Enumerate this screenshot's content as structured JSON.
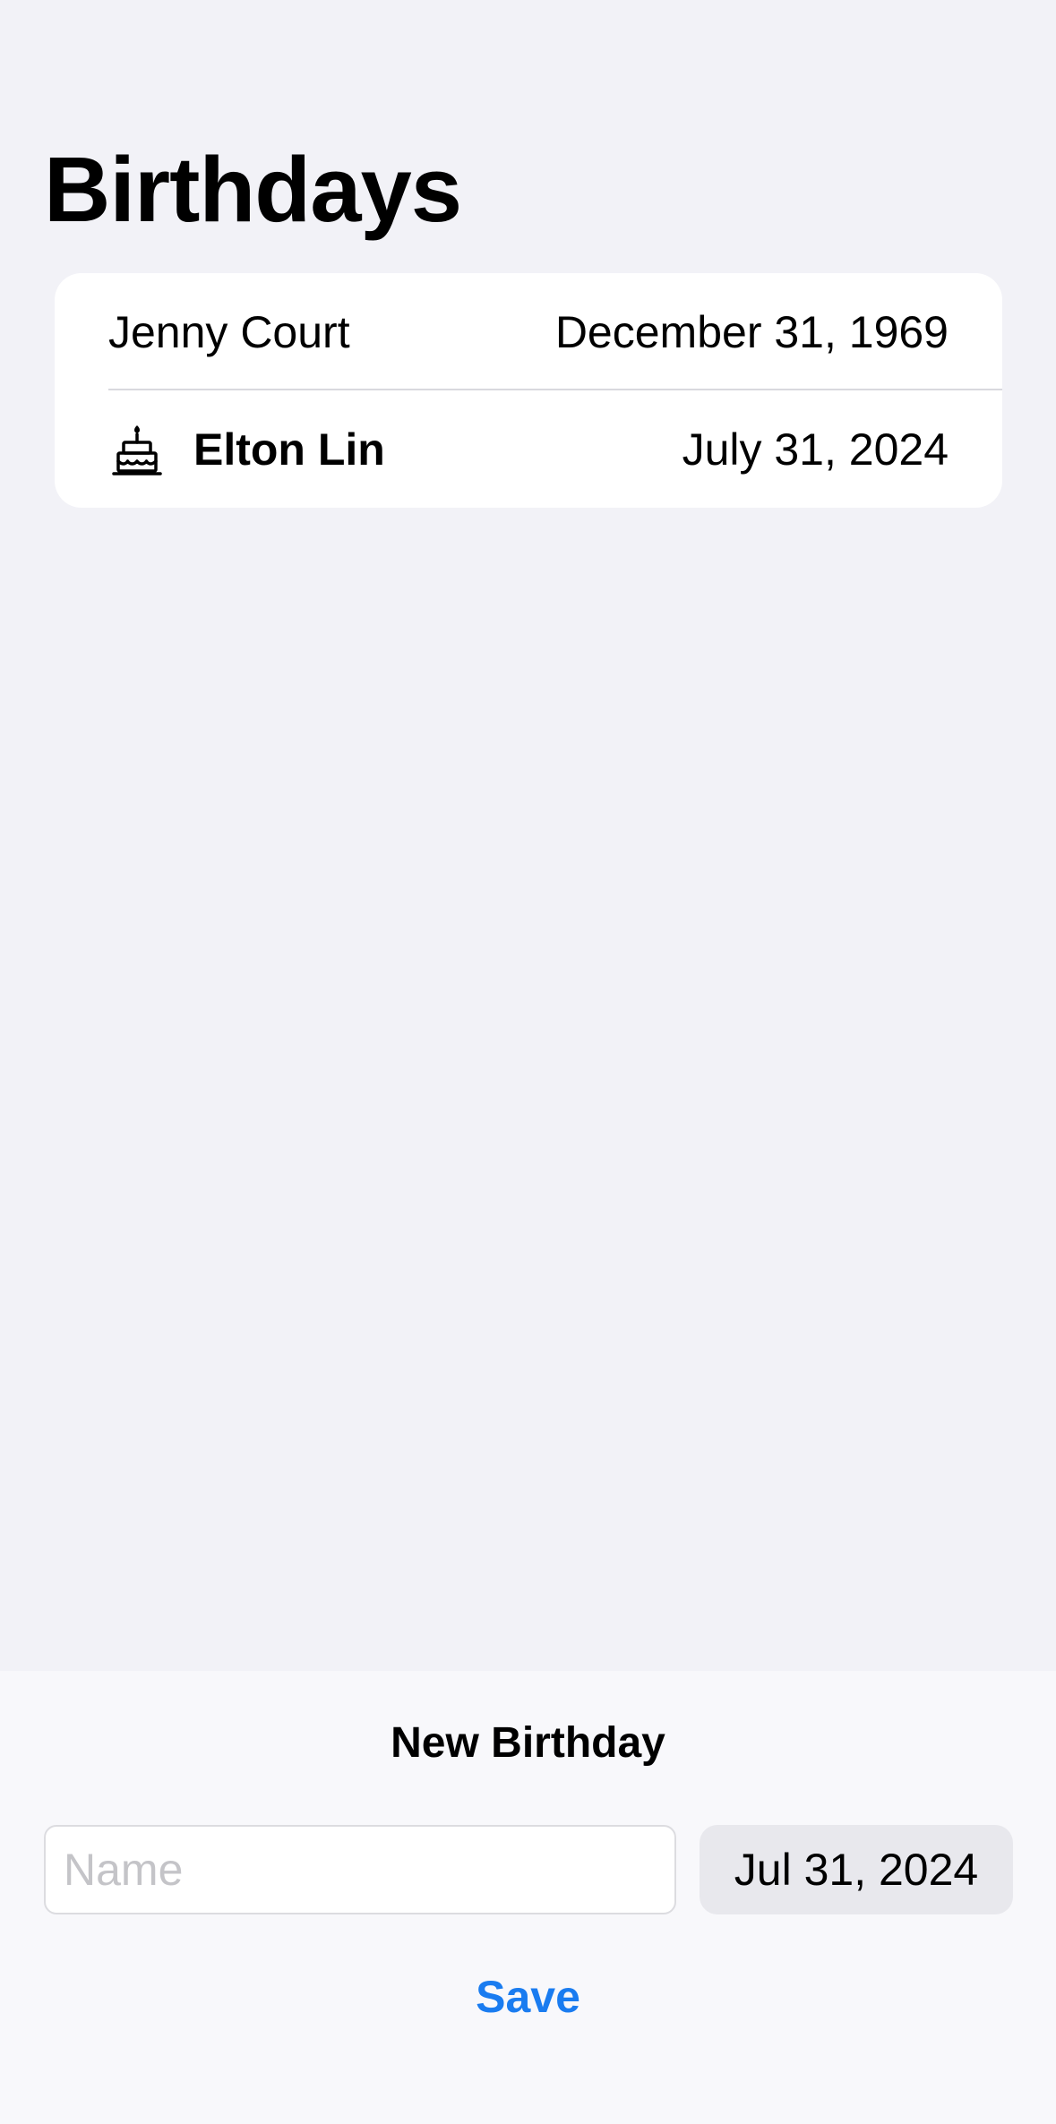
{
  "header": {
    "title": "Birthdays"
  },
  "birthdays": [
    {
      "name": "Jenny Court",
      "date": "December 31, 1969",
      "is_today": false
    },
    {
      "name": "Elton Lin",
      "date": "July 31, 2024",
      "is_today": true,
      "icon": "birthday-cake-icon"
    }
  ],
  "new_birthday": {
    "title": "New Birthday",
    "name_placeholder": "Name",
    "name_value": "",
    "date_value": "Jul 31, 2024",
    "save_label": "Save"
  },
  "colors": {
    "accent": "#1a7cf0",
    "background": "#f2f2f7",
    "card": "#ffffff"
  }
}
